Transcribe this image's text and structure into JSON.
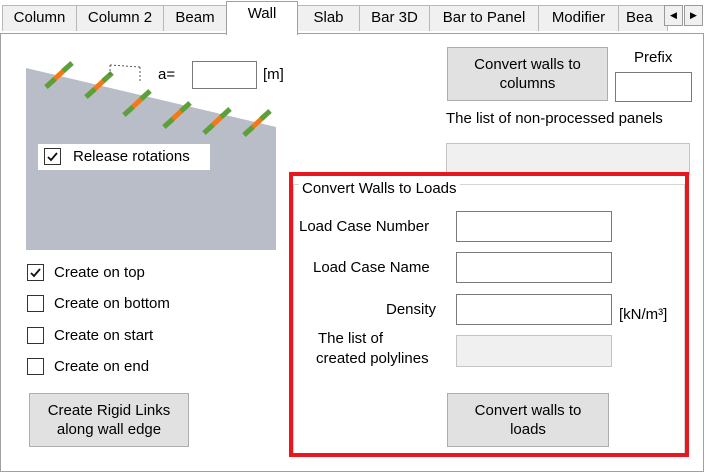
{
  "tabs": [
    "Column",
    "Column 2",
    "Beam",
    "Wall",
    "Slab",
    "Bar 3D",
    "Bar to Panel",
    "Modifier",
    "Bea"
  ],
  "active_tab": "Wall",
  "tab_scroll": {
    "left_arrow": "◀",
    "right_arrow": "▶"
  },
  "diagram": {
    "a_label": "a=",
    "a_value": "",
    "unit": "[m]",
    "release_rotations": {
      "label": "Release rotations",
      "checked": true
    }
  },
  "options": [
    {
      "label": "Create on top",
      "checked": true
    },
    {
      "label": "Create on bottom",
      "checked": false
    },
    {
      "label": "Create on start",
      "checked": false
    },
    {
      "label": "Create on end",
      "checked": false
    }
  ],
  "rigid_links_button": {
    "line1": "Create Rigid Links",
    "line2": "along wall edge"
  },
  "convert_columns_button": {
    "line1": "Convert walls to",
    "line2": "columns"
  },
  "prefix": {
    "label": "Prefix",
    "value": ""
  },
  "nonprocessed": {
    "label": "The list of non-processed panels",
    "value": ""
  },
  "loads_group": {
    "title": "Convert Walls to Loads",
    "load_case_number": {
      "label": "Load Case Number",
      "value": ""
    },
    "load_case_name": {
      "label": "Load Case Name",
      "value": ""
    },
    "density": {
      "label": "Density",
      "value": "",
      "unit": "[kN/m³]"
    },
    "polylines": {
      "label_line1": "The list of",
      "label_line2": "created polylines",
      "value": ""
    },
    "convert_button": {
      "line1": "Convert walls to",
      "line2": "loads"
    }
  },
  "colors": {
    "highlight": "#e8161e",
    "wall_fill": "#b8bdc7",
    "link_orange": "#f07a1a",
    "link_green": "#5aa13a"
  }
}
